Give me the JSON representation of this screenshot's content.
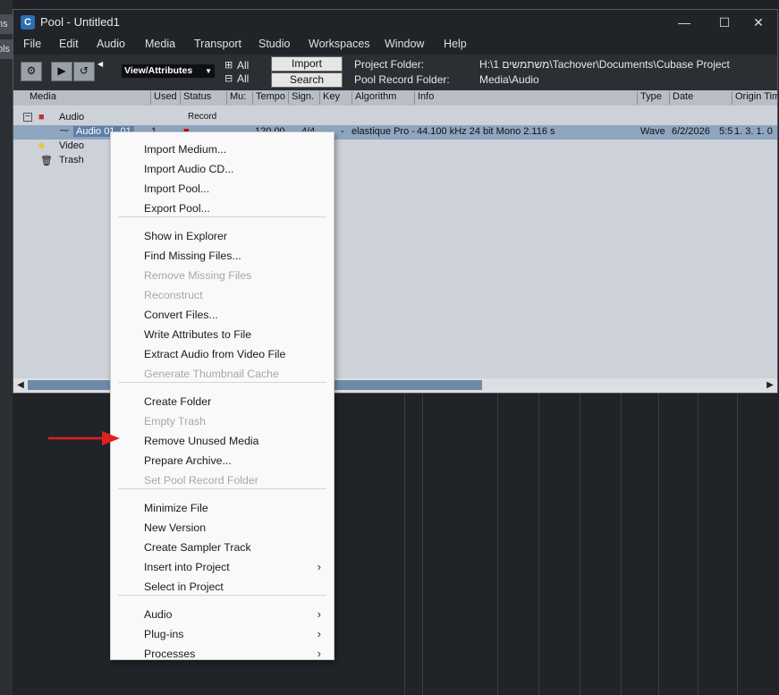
{
  "window": {
    "title": "Pool - Untitled1",
    "app_icon": "cubase-logo-icon",
    "controls": [
      "—",
      "☐",
      "✕"
    ]
  },
  "menubar": [
    "File",
    "Edit",
    "Audio",
    "Media",
    "Transport",
    "Studio",
    "Workspaces",
    "Window",
    "Help"
  ],
  "toolbar": {
    "view_select": "View/Attributes",
    "all_1": "All",
    "all_2": "All",
    "import_label": "Import",
    "search_label": "Search",
    "project_folder_label": "Project Folder:",
    "project_folder_value": "H:\\1 משתמשים\\Tachover\\Documents\\Cubase Project",
    "pool_record_label": "Pool Record Folder:",
    "pool_record_value": "Media\\Audio"
  },
  "columns": [
    "Media",
    "Used",
    "Status",
    "Mu:",
    "Tempo",
    "Sign.",
    "Key",
    "Algorithm",
    "Info",
    "Type",
    "Date",
    "Origin Tim"
  ],
  "tree": {
    "audio_folder": "Audio",
    "record_label": "Record",
    "audio_item": {
      "name": "Audio 01_01",
      "used": "1",
      "tempo": "120.00",
      "sign": "4/4",
      "key": "-",
      "algorithm": "elastique Pro -",
      "info": "44.100 kHz   24 bit   Mono   2.116 s",
      "type": "Wave",
      "date": "6/2/2026",
      "date_tail": "5:5",
      "origin": "1. 3. 1.  0"
    },
    "video_folder": "Video",
    "trash_folder": "Trash"
  },
  "left_panel_tabs": [
    "ns",
    "ols"
  ],
  "context_menu": {
    "groups": [
      [
        {
          "label": "Import Medium...",
          "enabled": true
        },
        {
          "label": "Import Audio CD...",
          "enabled": true
        },
        {
          "label": "Import Pool...",
          "enabled": true
        },
        {
          "label": "Export Pool...",
          "enabled": true
        }
      ],
      [
        {
          "label": "Show in Explorer",
          "enabled": true
        },
        {
          "label": "Find Missing Files...",
          "enabled": true
        },
        {
          "label": "Remove Missing Files",
          "enabled": false
        },
        {
          "label": "Reconstruct",
          "enabled": false
        },
        {
          "label": "Convert Files...",
          "enabled": true
        },
        {
          "label": "Write Attributes to File",
          "enabled": true
        },
        {
          "label": "Extract Audio from Video File",
          "enabled": true
        },
        {
          "label": "Generate Thumbnail Cache",
          "enabled": false
        }
      ],
      [
        {
          "label": "Create Folder",
          "enabled": true
        },
        {
          "label": "Empty Trash",
          "enabled": false
        },
        {
          "label": "Remove Unused Media",
          "enabled": true
        },
        {
          "label": "Prepare Archive...",
          "enabled": true
        },
        {
          "label": "Set Pool Record Folder",
          "enabled": false
        }
      ],
      [
        {
          "label": "Minimize File",
          "enabled": true
        },
        {
          "label": "New Version",
          "enabled": true
        },
        {
          "label": "Create Sampler Track",
          "enabled": true
        },
        {
          "label": "Insert into Project",
          "enabled": true,
          "submenu": true
        },
        {
          "label": "Select in Project",
          "enabled": true
        }
      ],
      [
        {
          "label": "Audio",
          "enabled": true,
          "submenu": true
        },
        {
          "label": "Plug-ins",
          "enabled": true,
          "submenu": true
        },
        {
          "label": "Processes",
          "enabled": true,
          "submenu": true
        }
      ]
    ]
  },
  "colors": {
    "annotation_arrow": "#e02020",
    "selected_row": "#8fa5c0",
    "pool_background": "#cdd2d9"
  }
}
